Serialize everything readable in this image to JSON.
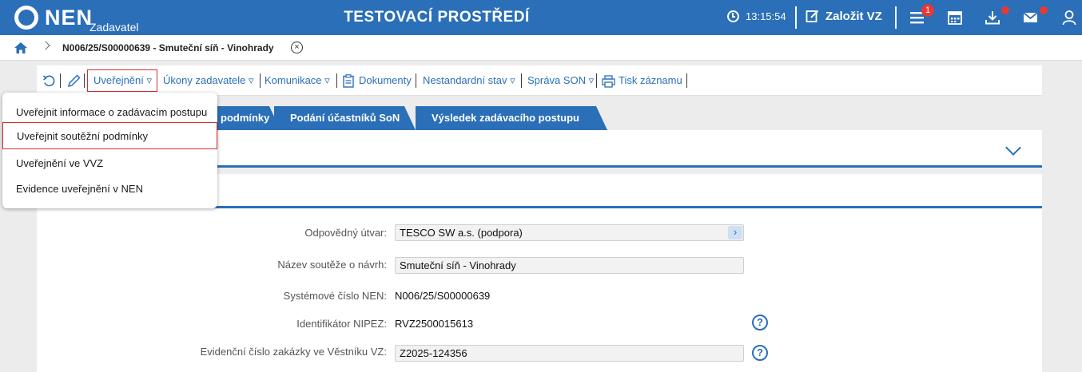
{
  "topbar": {
    "logo_text": "NEN",
    "logo_sub": "Zadavatel",
    "env_title": "TESTOVACÍ PROSTŘEDÍ",
    "clock": "13:15:54",
    "create_label": "Založit VZ",
    "notification_count": "1",
    "bg_color": "#2a6fb8",
    "badge_color": "#e53935"
  },
  "breadcrumb": {
    "title": "N006/25/S00000639 - Smuteční síň - Vinohrady",
    "close_glyph": "×"
  },
  "toolbar": {
    "items": [
      {
        "label": "Uveřejnění ▿"
      },
      {
        "label": "Úkony zadavatele ▿"
      },
      {
        "label": "Komunikace ▿"
      },
      {
        "label": "Dokumenty"
      },
      {
        "label": "Nestandardní stav ▿"
      },
      {
        "label": "Správa SON ▿"
      },
      {
        "label": "Tisk záznamu"
      }
    ]
  },
  "tabs": [
    {
      "label": "podmínky"
    },
    {
      "label": "Podání účastníků SoN"
    },
    {
      "label": "Výsledek zadávacího postupu"
    }
  ],
  "menu": {
    "items": [
      {
        "label": "Uveřejnit informace o zadávacím postupu"
      },
      {
        "label": "Uveřejnit soutěžní podmínky"
      },
      {
        "label": "Uveřejnění ve VVZ"
      },
      {
        "label": "Evidence uveřejnění v NEN"
      }
    ]
  },
  "form": {
    "unit": {
      "label": "Odpovědný útvar:",
      "value": "TESCO SW a.s. (podpora)",
      "button": "›"
    },
    "name": {
      "label": "Název soutěže o návrh:",
      "value": "Smuteční síň - Vinohrady"
    },
    "system_no": {
      "label": "Systémové číslo NEN:",
      "value": "N006/25/S00000639"
    },
    "nipez": {
      "label": "Identifikátor NIPEZ:",
      "value": "RVZ2500015613"
    },
    "vvz_no": {
      "label": "Evidenční číslo zakázky ve Věstníku VZ:",
      "value": "Z2025-124356"
    },
    "help_glyph": "?"
  }
}
